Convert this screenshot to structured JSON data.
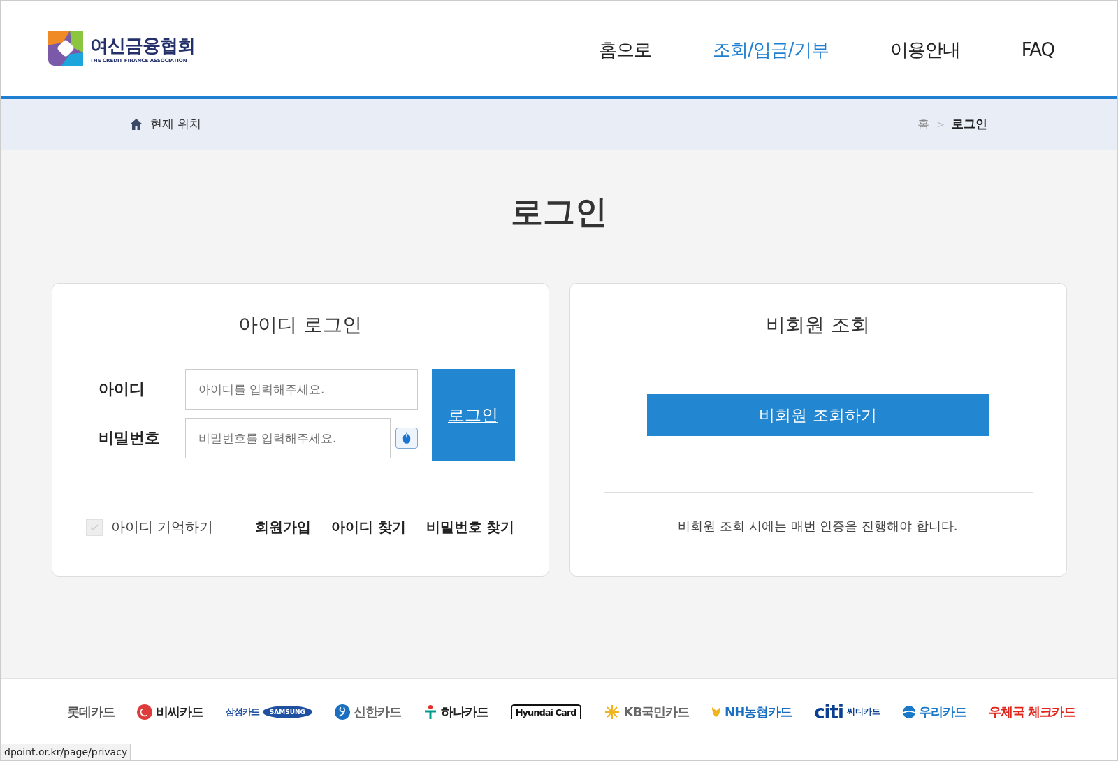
{
  "logo": {
    "title": "여신금융협회",
    "subtitle": "THE CREDIT FINANCE ASSOCIATION"
  },
  "nav": [
    {
      "label": "홈으로",
      "selected": false
    },
    {
      "label": "조회/입금/기부",
      "selected": true
    },
    {
      "label": "이용안내",
      "selected": false
    },
    {
      "label": "FAQ",
      "selected": false
    }
  ],
  "location": {
    "label": "현재 위치",
    "crumbs": [
      "홈",
      "로그인"
    ],
    "separator": ">"
  },
  "page_title": "로그인",
  "id_login": {
    "title": "아이디 로그인",
    "id_label": "아이디",
    "id_placeholder": "아이디를 입력해주세요.",
    "pw_label": "비밀번호",
    "pw_placeholder": "비밀번호를 입력해주세요.",
    "button": "로그인",
    "remember": {
      "label": "아이디 기억하기",
      "checked": false
    },
    "links": [
      "회원가입",
      "아이디 찾기",
      "비밀번호 찾기"
    ]
  },
  "guest": {
    "title": "비회원 조회",
    "button": "비회원 조회하기",
    "note": "비회원 조회 시에는 매번 인증을 진행해야 합니다."
  },
  "cards": [
    {
      "kind": "plain",
      "name": "롯데카드",
      "color": "#555555"
    },
    {
      "kind": "bc",
      "name": "비씨카드",
      "color": "#222222"
    },
    {
      "kind": "samsung",
      "name": "삼성카드",
      "badge": "SAMSUNG",
      "color": "#1f4fa0"
    },
    {
      "kind": "shinhan",
      "name": "신한카드",
      "color": "#666666"
    },
    {
      "kind": "hana",
      "name": "하나카드",
      "color": "#222222"
    },
    {
      "kind": "boxed",
      "name": "Hyundai Card",
      "color": "#111111"
    },
    {
      "kind": "kb",
      "name": "KB국민카드",
      "color": "#666666"
    },
    {
      "kind": "nh",
      "name": "NH농협카드",
      "color": "#1a6fc0"
    },
    {
      "kind": "citi",
      "name": "citi",
      "badge": "씨티카드",
      "color": "#0b3f8f"
    },
    {
      "kind": "woori",
      "name": "우리카드",
      "color": "#1a78c8"
    },
    {
      "kind": "plain",
      "name": "우체국 체크카드",
      "color": "#e2231a"
    }
  ],
  "status_url": "dpoint.or.kr/page/privacy"
}
